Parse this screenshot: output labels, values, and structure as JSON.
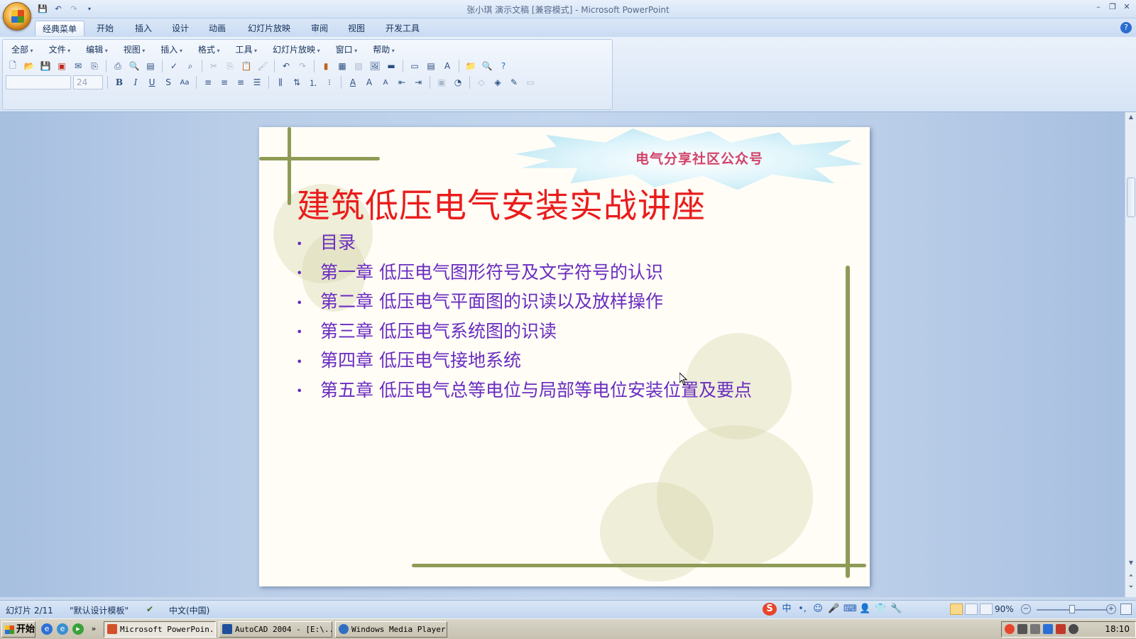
{
  "window": {
    "title": "张小琪 演示文稿 [兼容模式] - Microsoft PowerPoint",
    "controls": [
      "–",
      "❐",
      "✕"
    ]
  },
  "tabs": [
    "经典菜单",
    "开始",
    "插入",
    "设计",
    "动画",
    "幻灯片放映",
    "审阅",
    "视图",
    "开发工具"
  ],
  "active_tab": "经典菜单",
  "classic_menu": [
    "全部",
    "文件",
    "编辑",
    "视图",
    "插入",
    "格式",
    "工具",
    "幻灯片放映",
    "窗口",
    "帮助"
  ],
  "font_size_value": "24",
  "format_buttons": [
    "B",
    "I",
    "U",
    "S",
    "Aa"
  ],
  "slide": {
    "brand": "电气分享社区公众号",
    "title": "建筑低压电气安装实战讲座",
    "bullets": [
      "目录",
      "第一章  低压电气图形符号及文字符号的认识",
      "第二章  低压电气平面图的识读以及放样操作",
      "第三章  低压电气系统图的识读",
      "第四章  低压电气接地系统",
      "第五章  低压电气总等电位与局部等电位安装位置及要点"
    ],
    "bullet_char": "•"
  },
  "status": {
    "slide_info": "幻灯片 2/11",
    "theme": "\"默认设计模板\"",
    "language": "中文(中国)",
    "zoom": "90%",
    "zoom_level": 0.5
  },
  "ime": [
    "S",
    "中",
    "•,",
    "☺",
    "🎤",
    "⌨",
    "👤",
    "👕",
    "🔧"
  ],
  "taskbar": {
    "start": "开始",
    "more": "»",
    "tasks": [
      {
        "label": "Microsoft PowerPoin...",
        "active": true
      },
      {
        "label": "AutoCAD 2004 - [E:\\...",
        "active": false
      },
      {
        "label": "Windows Media Player",
        "active": false
      }
    ],
    "clock": "18:10"
  },
  "colors": {
    "title_red": "#ea1c1c",
    "bullet_purple": "#6a2cc0",
    "brand_pink": "#d1436a"
  }
}
